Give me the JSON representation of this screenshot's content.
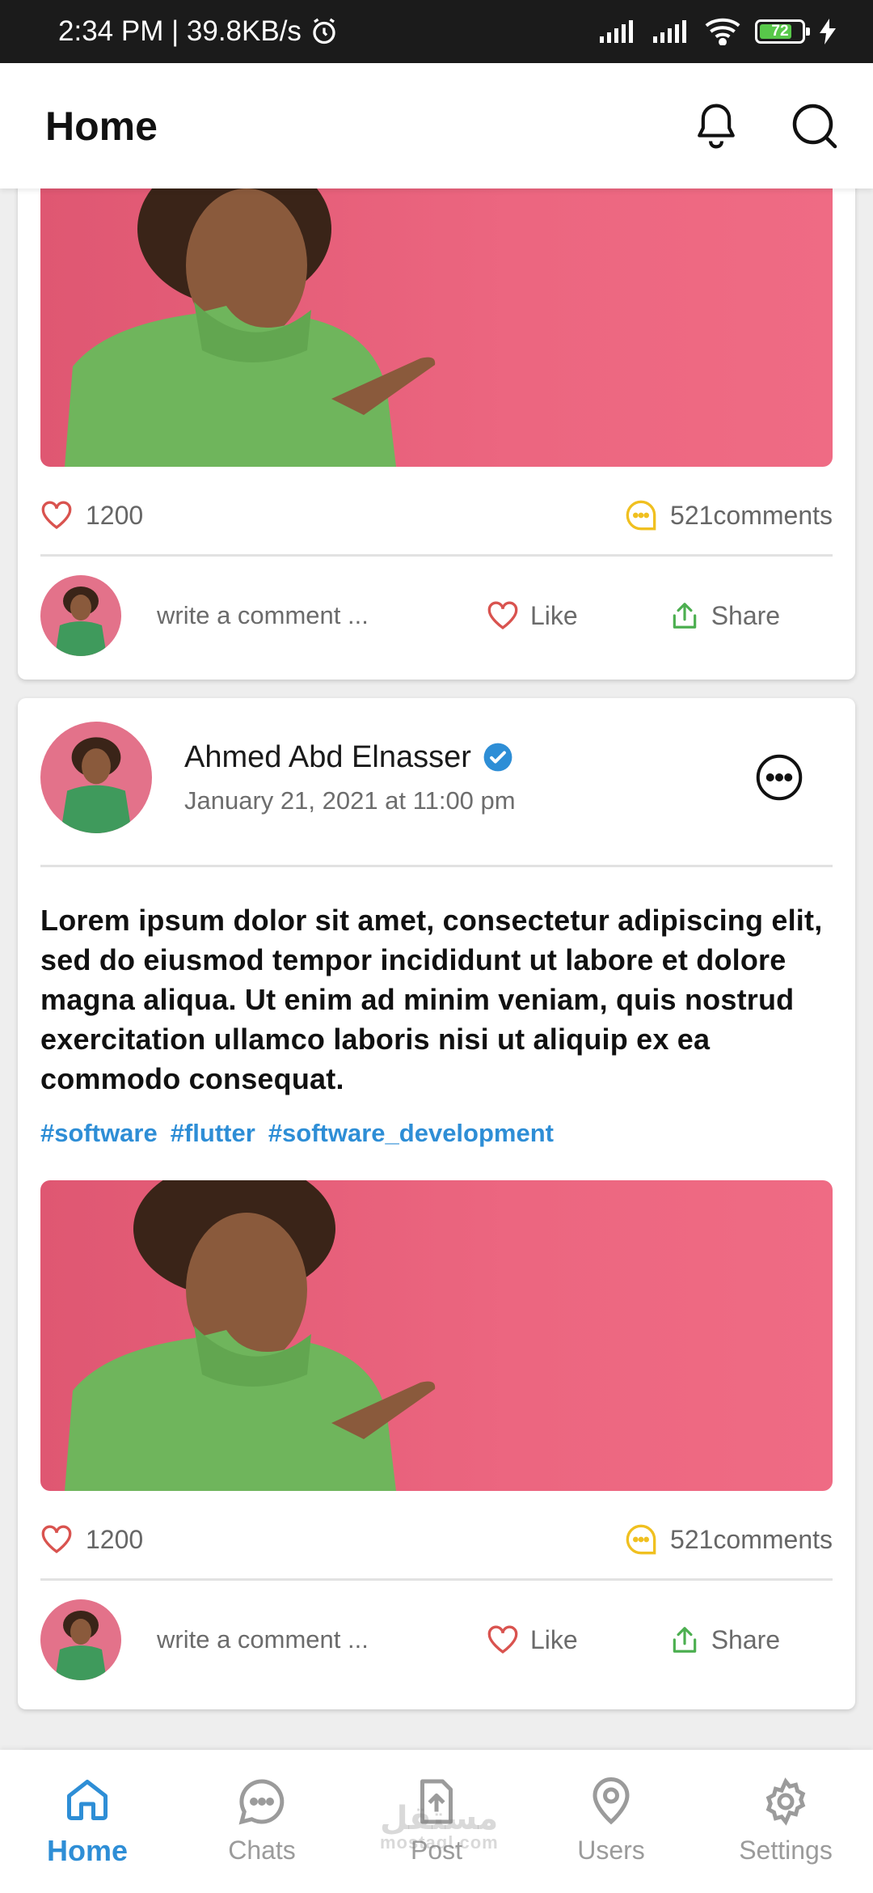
{
  "status_bar": {
    "time_speed": "2:34 PM | 39.8KB/s",
    "battery": "72"
  },
  "app_bar": {
    "title": "Home"
  },
  "posts": [
    {
      "likes": "1200",
      "comments": "521comments",
      "comment_placeholder": "write a comment ...",
      "like_label": "Like",
      "share_label": "Share"
    },
    {
      "author": "Ahmed Abd Elnasser",
      "date": "January 21, 2021 at 11:00 pm",
      "text": "Lorem ipsum dolor sit amet, consectetur adipiscing elit, sed do eiusmod tempor incididunt ut labore et dolore magna aliqua. Ut enim ad minim veniam, quis nostrud exercitation ullamco laboris nisi ut aliquip ex ea commodo consequat.",
      "hashtags": [
        "#software",
        "#flutter",
        "#software_development"
      ],
      "likes": "1200",
      "comments": "521comments",
      "comment_placeholder": "write a comment ...",
      "like_label": "Like",
      "share_label": "Share"
    }
  ],
  "bottom_nav": [
    {
      "label": "Home",
      "icon": "home-icon",
      "active": true
    },
    {
      "label": "Chats",
      "icon": "chat-icon",
      "active": false
    },
    {
      "label": "Post",
      "icon": "upload-icon",
      "active": false
    },
    {
      "label": "Users",
      "icon": "location-icon",
      "active": false
    },
    {
      "label": "Settings",
      "icon": "settings-icon",
      "active": false
    }
  ],
  "watermark": {
    "arabic": "مستقل",
    "latin": "mostaql.com"
  },
  "colors": {
    "accent": "#2e8ed6",
    "like": "#d9534f",
    "comment": "#f0c020",
    "share": "#4caf50"
  }
}
